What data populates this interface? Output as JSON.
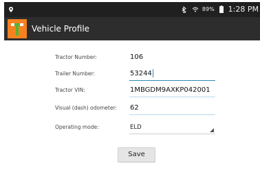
{
  "status_bar": {
    "battery": "89%",
    "time": "1:28 PM"
  },
  "action_bar": {
    "title": "Vehicle Profile",
    "logo_colors": {
      "orange": "#F58220",
      "green": "#5AB235"
    }
  },
  "form": {
    "tractor_number_label": "Tractor Number:",
    "tractor_number_value": "106",
    "trailer_number_label": "Trailer Number:",
    "trailer_number_value": "53244",
    "tractor_vin_label": "Tractor VIN:",
    "tractor_vin_value": "1MBGDM9AXKP042001",
    "odometer_label": "Visual (dash) odometer:",
    "odometer_value": "62",
    "operating_mode_label": "Operating mode:",
    "operating_mode_value": "ELD"
  },
  "buttons": {
    "save": "Save"
  },
  "icons": {
    "status_left": "location-icon",
    "status_right_1": "bluetooth-icon",
    "status_right_2": "wifi-icon",
    "status_right_3": "battery-icon"
  }
}
